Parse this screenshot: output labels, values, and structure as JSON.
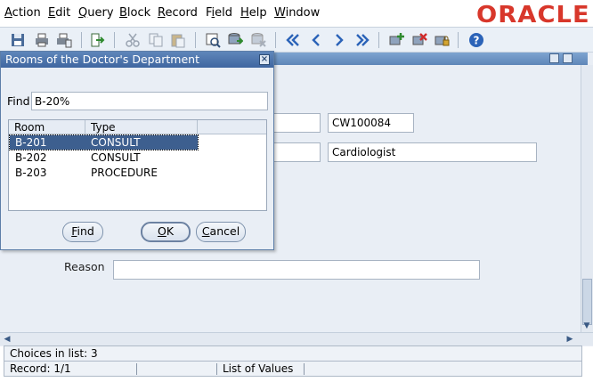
{
  "menu": {
    "items": [
      {
        "pre": "",
        "u": "A",
        "post": "ction"
      },
      {
        "pre": "",
        "u": "E",
        "post": "dit"
      },
      {
        "pre": "",
        "u": "Q",
        "post": "uery"
      },
      {
        "pre": "",
        "u": "B",
        "post": "lock"
      },
      {
        "pre": "",
        "u": "R",
        "post": "ecord"
      },
      {
        "pre": "F",
        "u": "i",
        "post": "eld"
      },
      {
        "pre": "",
        "u": "H",
        "post": "elp"
      },
      {
        "pre": "",
        "u": "W",
        "post": "indow"
      }
    ],
    "logo": "ORACLE"
  },
  "background_form": {
    "field_code": "CW100084",
    "field_specialty": "Cardiologist",
    "reason_label": "Reason",
    "reason_value": ""
  },
  "lov": {
    "title": "Rooms of the Doctor's Department",
    "find_label": "Find",
    "find_value": "B-20%",
    "columns": [
      "Room",
      "Type"
    ],
    "rows": [
      {
        "room": "B-201",
        "type": "CONSULT",
        "selected": true
      },
      {
        "room": "B-202",
        "type": "CONSULT",
        "selected": false
      },
      {
        "room": "B-203",
        "type": "PROCEDURE",
        "selected": false
      }
    ],
    "buttons": {
      "find": {
        "u": "F",
        "rest": "ind"
      },
      "ok": {
        "u": "O",
        "rest": "K"
      },
      "cancel": {
        "u": "C",
        "rest": "ancel"
      }
    },
    "close_glyph": "×"
  },
  "status": {
    "choices": "Choices in list: 3",
    "record": "Record: 1/1",
    "mode": "List of Values"
  },
  "colors": {
    "oracle_red": "#d8372b",
    "selection": "#3d5f8f",
    "titlebar": "#3f66a0"
  }
}
